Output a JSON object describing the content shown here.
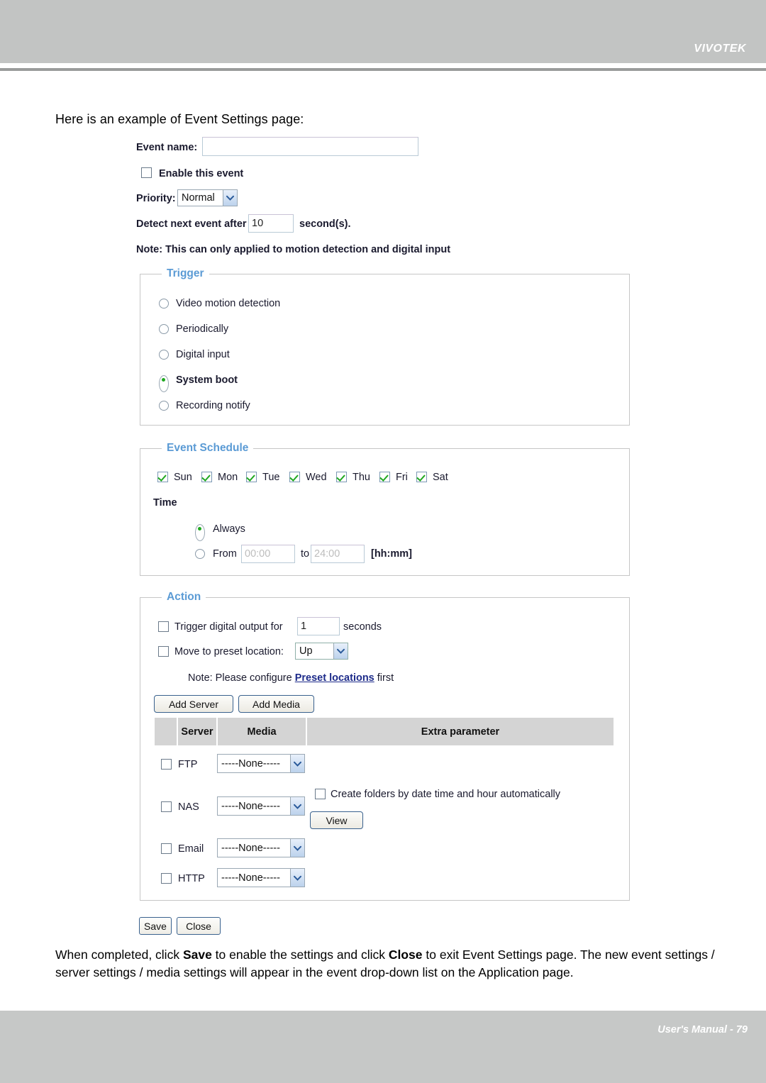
{
  "header": {
    "brand": "VIVOTEK"
  },
  "footer": {
    "text": "User's Manual - 79"
  },
  "intro": "Here is an example of Event Settings page:",
  "event_form": {
    "event_name_label": "Event name:",
    "event_name_value": "",
    "enable_event_label": "Enable this event",
    "enable_event_checked": false,
    "priority_label": "Priority:",
    "priority_value": "Normal",
    "detect_prefix": "Detect next event after",
    "detect_value": "10",
    "detect_suffix": "second(s).",
    "note": "Note: This can only applied to motion detection and digital input"
  },
  "trigger": {
    "legend": "Trigger",
    "options": [
      {
        "label": "Video motion detection",
        "selected": false
      },
      {
        "label": "Periodically",
        "selected": false
      },
      {
        "label": "Digital input",
        "selected": false
      },
      {
        "label": "System boot",
        "selected": true
      },
      {
        "label": "Recording notify",
        "selected": false
      }
    ]
  },
  "event_schedule": {
    "legend": "Event Schedule",
    "days": [
      {
        "label": "Sun",
        "checked": true
      },
      {
        "label": "Mon",
        "checked": true
      },
      {
        "label": "Tue",
        "checked": true
      },
      {
        "label": "Wed",
        "checked": true
      },
      {
        "label": "Thu",
        "checked": true
      },
      {
        "label": "Fri",
        "checked": true
      },
      {
        "label": "Sat",
        "checked": true
      }
    ],
    "time_label": "Time",
    "always_label": "Always",
    "always_selected": true,
    "from_label": "From",
    "from_placeholder": "00:00",
    "to_label": "to",
    "to_placeholder": "24:00",
    "format_hint": "[hh:mm]",
    "range_selected": false
  },
  "action": {
    "legend": "Action",
    "trigger_do_prefix": "Trigger digital output for",
    "trigger_do_value": "1",
    "trigger_do_suffix": "seconds",
    "trigger_do_checked": false,
    "preset_label": "Move to preset location:",
    "preset_value": "Up",
    "preset_checked": false,
    "preset_note_pre": "Note: Please configure ",
    "preset_note_link": "Preset locations",
    "preset_note_post": " first",
    "add_server_label": "Add Server",
    "add_media_label": "Add Media",
    "table": {
      "headers": [
        "",
        "Server",
        "Media",
        "Extra parameter"
      ],
      "rows": [
        {
          "name": "FTP",
          "checked": false,
          "media": "-----None-----",
          "extra": ""
        },
        {
          "name": "NAS",
          "checked": false,
          "media": "-----None-----",
          "extra": "create-folders"
        },
        {
          "name": "Email",
          "checked": false,
          "media": "-----None-----",
          "extra": ""
        },
        {
          "name": "HTTP",
          "checked": false,
          "media": "-----None-----",
          "extra": ""
        }
      ],
      "create_folders_label": "Create folders by date time and hour automatically",
      "create_folders_checked": false,
      "view_label": "View"
    }
  },
  "buttons": {
    "save_label": "Save",
    "close_label": "Close"
  },
  "outro": {
    "p1": "When completed, click ",
    "b1": "Save",
    "p2": " to enable the settings and click ",
    "b2": "Close",
    "p3": " to exit Event Settings page. The new event settings / server settings / media settings will appear in the event drop-down list on the Application page."
  },
  "colors": {
    "band": "#c2c4c3",
    "legend": "#5b9bd5",
    "check": "#1fa81f",
    "link": "#1d2b8a"
  }
}
